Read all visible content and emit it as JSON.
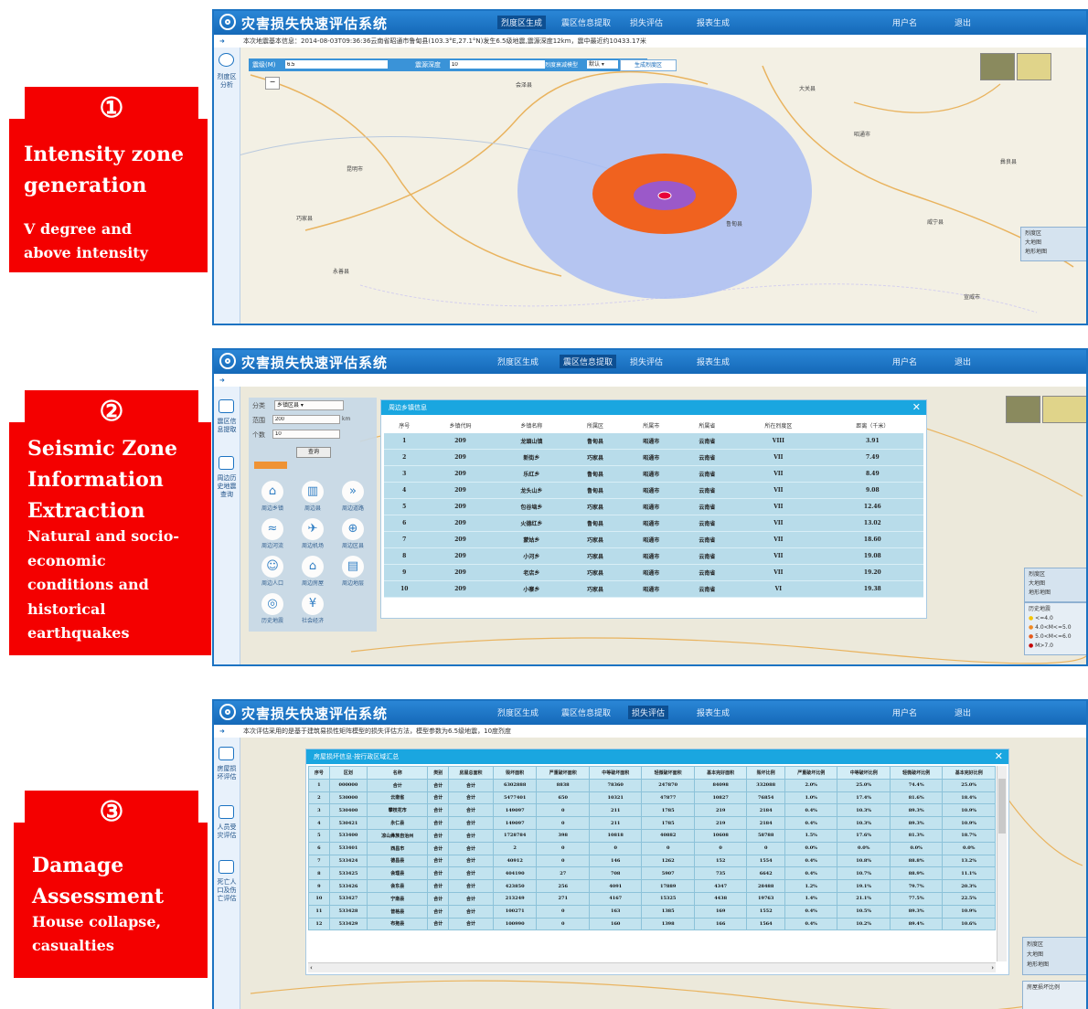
{
  "steps": [
    {
      "number": "①",
      "title_lines": [
        "Intensity zone",
        "generation"
      ],
      "subtitle_lines": [
        "V degree and",
        "above intensity"
      ]
    },
    {
      "number": "②",
      "title_lines": [
        "Seismic Zone",
        "Information",
        "Extraction"
      ],
      "subtitle_lines": [
        "Natural and socio-",
        "economic",
        "conditions and",
        "historical",
        "earthquakes"
      ]
    },
    {
      "number": "③",
      "title_lines": [
        "Damage",
        "Assessment"
      ],
      "subtitle_lines": [
        "House collapse,",
        "casualties"
      ]
    }
  ],
  "app": {
    "title": "灾害损失快速评估系统",
    "nav": [
      "烈度区生成",
      "震区信息提取",
      "损失评估",
      "报表生成"
    ],
    "right_links": [
      "用户名",
      "退出"
    ]
  },
  "panel1": {
    "info": "本次地震基本信息：2014-08-03T09:36:36云南省昭通市鲁甸县(103.3°E,27.1°N)发生6.5级地震,震源深度12km，震中最近约10433.17米",
    "magnitude_label": "震级(M)",
    "magnitude_value": "6.5",
    "depth_label": "震源深度",
    "depth_value": "10",
    "model_label": "烈度衰减模型",
    "model_value": "默认",
    "generate_button": "生成烈度区",
    "side_label": "烈度区分析",
    "map_labels": [
      "昆明市",
      "巧家县",
      "鲁甸县",
      "昭通市",
      "威宁县",
      "会泽县",
      "彝良县",
      "大关县",
      "永善县",
      "宣威市"
    ],
    "legend": [
      "烈度区",
      "大地图",
      "地形地图"
    ]
  },
  "panel2": {
    "controls": {
      "type_label": "分类",
      "type_value": "乡镇区县",
      "radius_label": "范围",
      "radius_value": "200",
      "radius_unit": "km",
      "count_label": "个数",
      "count_value": "10",
      "query_button": "查询"
    },
    "side_labels": [
      "震区信息提取",
      "周边历史地震查询"
    ],
    "icon_labels": [
      "周边乡镇",
      "周边县",
      "周边道路",
      "周边河流",
      "周边机场",
      "周边区县",
      "周边人口",
      "周边房屋",
      "周边地层",
      "历史地震",
      "社会经济"
    ],
    "modal_title": "周边乡镇信息",
    "headers": [
      "序号",
      "乡镇代码",
      "乡镇名称",
      "所属区",
      "所属市",
      "所属省",
      "所在烈度区",
      "距离（千米）"
    ],
    "rows": [
      [
        "1",
        "209",
        "龙頭山镇",
        "鲁甸县",
        "昭通市",
        "云南省",
        "VIII",
        "3.91"
      ],
      [
        "2",
        "209",
        "新街乡",
        "巧家县",
        "昭通市",
        "云南省",
        "VII",
        "7.49"
      ],
      [
        "3",
        "209",
        "乐红乡",
        "鲁甸县",
        "昭通市",
        "云南省",
        "VII",
        "8.49"
      ],
      [
        "4",
        "209",
        "龙头山乡",
        "鲁甸县",
        "昭通市",
        "云南省",
        "VII",
        "9.08"
      ],
      [
        "5",
        "209",
        "包谷垴乡",
        "巧家县",
        "昭通市",
        "云南省",
        "VII",
        "12.46"
      ],
      [
        "6",
        "209",
        "火德红乡",
        "鲁甸县",
        "昭通市",
        "云南省",
        "VII",
        "13.02"
      ],
      [
        "7",
        "209",
        "蒙姑乡",
        "巧家县",
        "昭通市",
        "云南省",
        "VII",
        "18.60"
      ],
      [
        "8",
        "209",
        "小河乡",
        "巧家县",
        "昭通市",
        "云南省",
        "VII",
        "19.08"
      ],
      [
        "9",
        "209",
        "老店乡",
        "巧家县",
        "昭通市",
        "云南省",
        "VII",
        "19.20"
      ],
      [
        "10",
        "209",
        "小寨乡",
        "巧家县",
        "昭通市",
        "云南省",
        "VI",
        "19.38"
      ]
    ],
    "legend": [
      "烈度区",
      "大地图",
      "地形地图"
    ],
    "history_legend_title": "历史地震",
    "history_legend": [
      "<=4.0",
      "4.0<M<=5.0",
      "5.0<M<=6.0",
      "M>7.0"
    ]
  },
  "panel3": {
    "info": "本次评估采用的是基于建筑易损性矩阵模型的损失评估方法，模型参数为6.5级地震，10度烈度",
    "side_labels": [
      "房屋损坏评估",
      "人员受灾评估",
      "死亡人口及伤亡评估"
    ],
    "modal_title": "房屋损坏信息·按行政区域汇总",
    "headers": [
      "序号",
      "区划",
      "名称",
      "类别",
      "房屋结构类型",
      "房屋总面积",
      "毁坏面积",
      "严重破坏面积",
      "中等破坏面积",
      "轻微破坏面积",
      "基本完好面积",
      "毁坏比例",
      "严重破坏比例",
      "中等破坏比例",
      "轻微破坏比例",
      "基本完好比例"
    ],
    "rows": [
      [
        "1",
        "000000",
        "合计",
        "合计",
        "合计",
        "6302888",
        "8838",
        "78360",
        "247870",
        "84098",
        "332088",
        "2.0%",
        "25.0%",
        "74.4%",
        "25.0%"
      ],
      [
        "2",
        "530000",
        "云南省",
        "合计",
        "合计",
        "5477401",
        "650",
        "10321",
        "47877",
        "10827",
        "76854",
        "1.0%",
        "17.4%",
        "81.6%",
        "18.4%"
      ],
      [
        "3",
        "530400",
        "攀枝花市",
        "合计",
        "合计",
        "149097",
        "0",
        "211",
        "1785",
        "219",
        "2184",
        "0.4%",
        "10.3%",
        "89.3%",
        "10.9%"
      ],
      [
        "4",
        "530421",
        "永仁县",
        "合计",
        "合计",
        "149097",
        "0",
        "211",
        "1785",
        "219",
        "2184",
        "0.4%",
        "10.3%",
        "89.3%",
        "10.9%"
      ],
      [
        "5",
        "533400",
        "凉山彝族自治州",
        "合计",
        "合计",
        "1728784",
        "398",
        "10818",
        "40882",
        "10608",
        "58788",
        "1.5%",
        "17.6%",
        "81.3%",
        "18.7%"
      ],
      [
        "6",
        "533401",
        "西昌市",
        "合计",
        "合计",
        "2",
        "0",
        "0",
        "0",
        "0",
        "0",
        "0.0%",
        "0.0%",
        "0.0%",
        "0.0%"
      ],
      [
        "7",
        "533424",
        "德昌县",
        "合计",
        "合计",
        "40912",
        "0",
        "146",
        "1262",
        "152",
        "1554",
        "0.4%",
        "10.8%",
        "88.8%",
        "13.2%"
      ],
      [
        "8",
        "533425",
        "会理县",
        "合计",
        "合计",
        "404190",
        "27",
        "708",
        "5907",
        "735",
        "6642",
        "0.4%",
        "10.7%",
        "88.9%",
        "11.1%"
      ],
      [
        "9",
        "533426",
        "会东县",
        "合计",
        "合计",
        "423850",
        "256",
        "4091",
        "17889",
        "4347",
        "28488",
        "1.2%",
        "19.1%",
        "79.7%",
        "20.3%"
      ],
      [
        "10",
        "533427",
        "宁南县",
        "合计",
        "合计",
        "213249",
        "271",
        "4167",
        "15325",
        "4438",
        "19763",
        "1.4%",
        "21.1%",
        "77.5%",
        "22.5%"
      ],
      [
        "11",
        "533428",
        "普格县",
        "合计",
        "合计",
        "100271",
        "0",
        "163",
        "1385",
        "169",
        "1552",
        "0.4%",
        "10.5%",
        "89.3%",
        "10.9%"
      ],
      [
        "12",
        "533429",
        "布拖县",
        "合计",
        "合计",
        "100990",
        "0",
        "160",
        "1398",
        "166",
        "1564",
        "0.4%",
        "10.2%",
        "89.4%",
        "10.6%"
      ]
    ],
    "legend": [
      "烈度区",
      "大地图",
      "地形地图"
    ],
    "legend2_title": "房屋损坏比例"
  },
  "colors": {
    "red_box": "#f40000",
    "topbar": "#1569b8",
    "modal_header": "#1aa6e0",
    "zone_outer": "#a9bdf3",
    "zone_mid": "#f0621f",
    "zone_inner": "#9b59c9",
    "zone_core": "#e8003a"
  }
}
